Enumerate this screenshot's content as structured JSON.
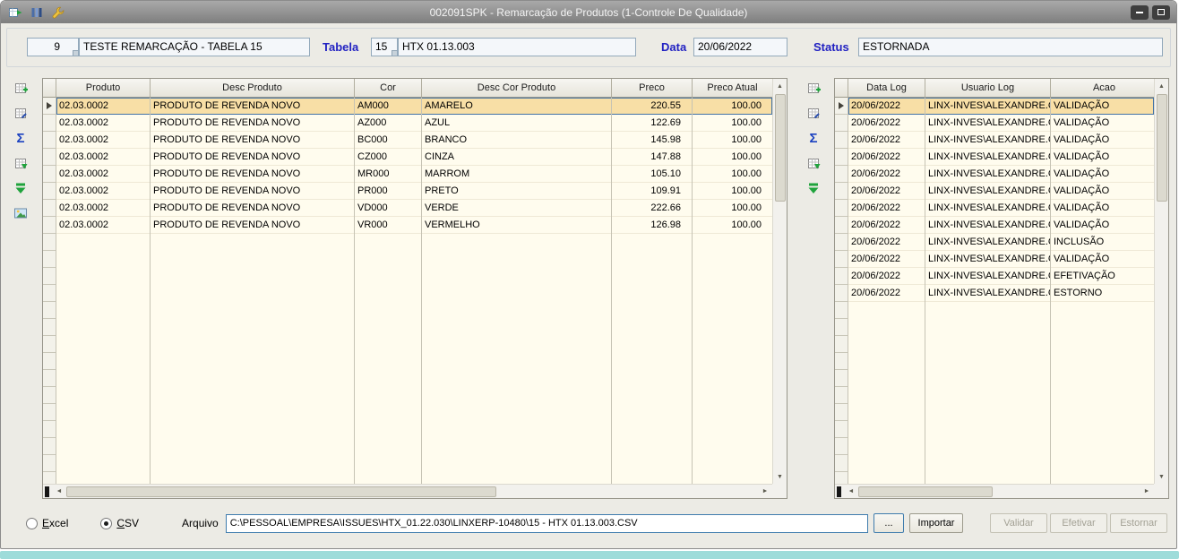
{
  "window": {
    "title": "002091SPK - Remarcação de Produtos (1-Controle De Qualidade)"
  },
  "titlebar_icons": [
    "window-export-icon",
    "columns-icon",
    "wrench-icon"
  ],
  "header": {
    "code": "9",
    "description": "TESTE REMARCAÇÃO - TABELA 15",
    "tabela_label": "Tabela",
    "tabela_num": "15",
    "tabela_desc": "HTX 01.13.003",
    "data_label": "Data",
    "data_value": "20/06/2022",
    "status_label": "Status",
    "status_value": "ESTORNADA"
  },
  "left_toolbar": {
    "icons": [
      "grid-insert-icon",
      "grid-edit-icon",
      "sum-icon",
      "grid-export-icon",
      "download-icon",
      "image-icon"
    ]
  },
  "right_toolbar": {
    "icons": [
      "grid-insert-icon",
      "grid-edit-icon",
      "sum-icon",
      "grid-export-icon",
      "download-icon"
    ]
  },
  "products_grid": {
    "columns": [
      "Produto",
      "Desc Produto",
      "Cor",
      "Desc Cor Produto",
      "Preco",
      "Preco Atual"
    ],
    "rows": [
      [
        "02.03.0002",
        "PRODUTO DE REVENDA NOVO",
        "AM000",
        "AMARELO",
        "220.55",
        "100.00"
      ],
      [
        "02.03.0002",
        "PRODUTO DE REVENDA NOVO",
        "AZ000",
        "AZUL",
        "122.69",
        "100.00"
      ],
      [
        "02.03.0002",
        "PRODUTO DE REVENDA NOVO",
        "BC000",
        "BRANCO",
        "145.98",
        "100.00"
      ],
      [
        "02.03.0002",
        "PRODUTO DE REVENDA NOVO",
        "CZ000",
        "CINZA",
        "147.88",
        "100.00"
      ],
      [
        "02.03.0002",
        "PRODUTO DE REVENDA NOVO",
        "MR000",
        "MARROM",
        "105.10",
        "100.00"
      ],
      [
        "02.03.0002",
        "PRODUTO DE REVENDA NOVO",
        "PR000",
        "PRETO",
        "109.91",
        "100.00"
      ],
      [
        "02.03.0002",
        "PRODUTO DE REVENDA NOVO",
        "VD000",
        "VERDE",
        "222.66",
        "100.00"
      ],
      [
        "02.03.0002",
        "PRODUTO DE REVENDA NOVO",
        "VR000",
        "VERMELHO",
        "126.98",
        "100.00"
      ]
    ]
  },
  "log_grid": {
    "columns": [
      "Data Log",
      "Usuario Log",
      "Acao"
    ],
    "rows": [
      [
        "20/06/2022",
        "LINX-INVES\\ALEXANDRE.C",
        "VALIDAÇÃO"
      ],
      [
        "20/06/2022",
        "LINX-INVES\\ALEXANDRE.C",
        "VALIDAÇÃO"
      ],
      [
        "20/06/2022",
        "LINX-INVES\\ALEXANDRE.C",
        "VALIDAÇÃO"
      ],
      [
        "20/06/2022",
        "LINX-INVES\\ALEXANDRE.C",
        "VALIDAÇÃO"
      ],
      [
        "20/06/2022",
        "LINX-INVES\\ALEXANDRE.C",
        "VALIDAÇÃO"
      ],
      [
        "20/06/2022",
        "LINX-INVES\\ALEXANDRE.C",
        "VALIDAÇÃO"
      ],
      [
        "20/06/2022",
        "LINX-INVES\\ALEXANDRE.C",
        "VALIDAÇÃO"
      ],
      [
        "20/06/2022",
        "LINX-INVES\\ALEXANDRE.C",
        "VALIDAÇÃO"
      ],
      [
        "20/06/2022",
        "LINX-INVES\\ALEXANDRE.C",
        "INCLUSÃO"
      ],
      [
        "20/06/2022",
        "LINX-INVES\\ALEXANDRE.C",
        "VALIDAÇÃO"
      ],
      [
        "20/06/2022",
        "LINX-INVES\\ALEXANDRE.C",
        "EFETIVAÇÃO"
      ],
      [
        "20/06/2022",
        "LINX-INVES\\ALEXANDRE.C",
        "ESTORNO"
      ]
    ]
  },
  "footer": {
    "excel_label": "Excel",
    "csv_label": "CSV",
    "csv_selected": true,
    "arquivo_label": "Arquivo",
    "arquivo_value": "C:\\PESSOAL\\EMPRESA\\ISSUES\\HTX_01.22.030\\LINXERP-10480\\15 - HTX 01.13.003.CSV",
    "browse_label": "...",
    "importar_label": "Importar",
    "validar_label": "Validar",
    "efetivar_label": "Efetivar",
    "estornar_label": "Estornar"
  },
  "glyphs": {
    "sum": "Σ",
    "scroll_up": "▲",
    "scroll_down": "▼",
    "scroll_left": "◄",
    "scroll_right": "►"
  },
  "colors": {
    "label_blue": "#2222c2",
    "grid_background": "#fffcee",
    "selection_background": "#f8dfa6",
    "selection_border": "#4473a5",
    "titlebar_gray": "#8f8f8f",
    "bottom_edge_teal": "#9edcda",
    "icon_green": "#1fa33c",
    "sigma_blue": "#1b41c0"
  }
}
